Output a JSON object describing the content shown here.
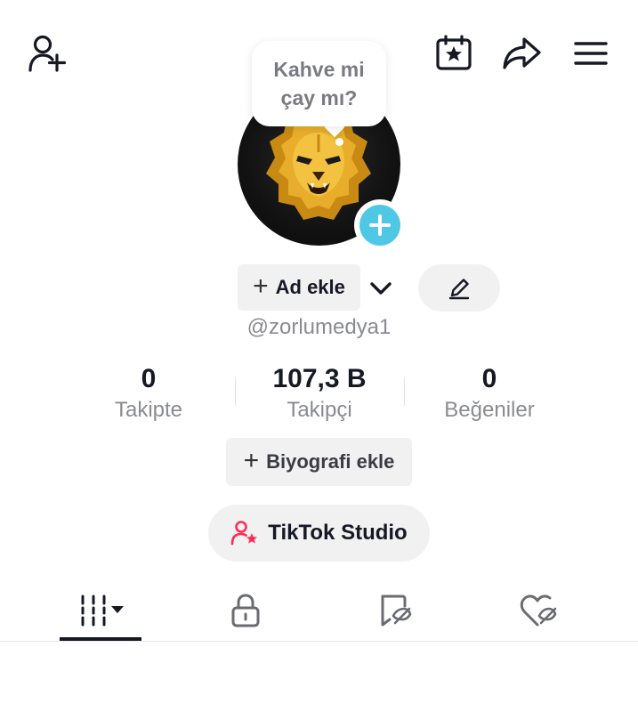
{
  "header": {
    "icons": [
      "add-friend-icon",
      "calendar-star-icon",
      "share-icon",
      "menu-icon"
    ]
  },
  "bubble": {
    "line1": "Kahve mi",
    "line2": "çay mı?"
  },
  "profile": {
    "name_button_label": "Ad ekle",
    "username": "@zorlumedya1"
  },
  "stats": [
    {
      "value": "0",
      "label": "Takipte"
    },
    {
      "value": "107,3 B",
      "label": "Takipçi"
    },
    {
      "value": "0",
      "label": "Beğeniler"
    }
  ],
  "bio_button_label": "Biyografi ekle",
  "studio_button_label": "TikTok Studio",
  "tabs": {
    "icons": [
      "videos-grid-icon",
      "lock-icon",
      "repost-icon",
      "liked-icon"
    ],
    "active": 0
  },
  "colors": {
    "accent_blue": "#4fc8e6",
    "studio_icon": "#fe2c55",
    "text_primary": "#161823",
    "text_secondary": "#8a8b91",
    "button_bg": "#f1f1f2"
  }
}
